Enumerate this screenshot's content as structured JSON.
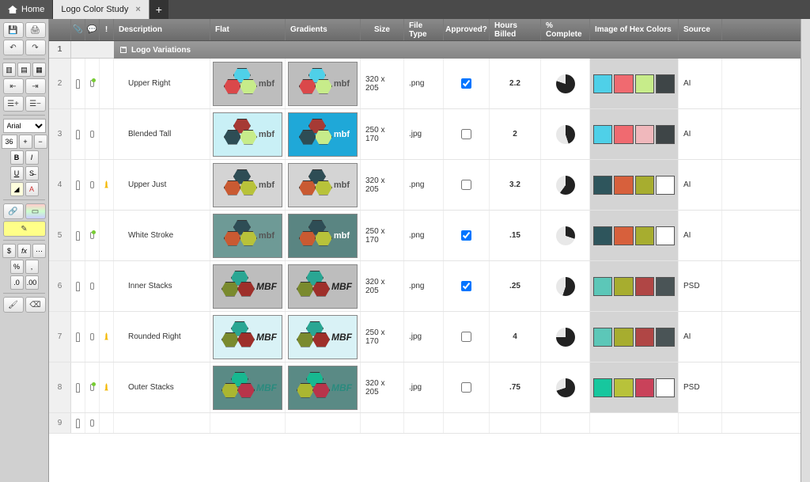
{
  "tabs": {
    "home": "Home",
    "active": "Logo Color Study"
  },
  "toolbar": {
    "font": "Arial",
    "size": "36"
  },
  "headers": {
    "description": "Description",
    "flat": "Flat",
    "gradients": "Gradients",
    "size": "Size",
    "filetype": "File Type",
    "approved": "Approved?",
    "hours": "Hours Billed",
    "pct": "% Complete",
    "hex": "Image of Hex Colors",
    "source": "Source"
  },
  "group": {
    "label": "Logo Variations"
  },
  "rows": [
    {
      "num": "2",
      "desc": "Upper Right",
      "size": "320 x 205",
      "ft": ".png",
      "approved": true,
      "hours": "2.2",
      "pct": 80,
      "src": "AI",
      "comment_has": true,
      "bell": false,
      "flat_bg": "#bdbdbd",
      "grad_bg": "#bdbdbd",
      "logo_text": "mbf",
      "logo_style": "thin",
      "hex_c": [
        "#4fd0e8",
        "#da484a",
        "#c7ec8a"
      ],
      "swatches": [
        "#4fd0e8",
        "#f06a70",
        "#c7ec8a",
        "#3e4547"
      ]
    },
    {
      "num": "3",
      "desc": "Blended Tall",
      "size": "250 x 170",
      "ft": ".jpg",
      "approved": false,
      "hours": "2",
      "pct": 45,
      "src": "AI",
      "comment_has": false,
      "bell": false,
      "flat_bg": "#c9f0f6",
      "grad_bg": "#1fa8d8",
      "logo_text": "mbf",
      "logo_style": "thin",
      "hex_c": [
        "#a63a35",
        "#2e4d55",
        "#c7ec8a"
      ],
      "swatches": [
        "#4fd0e8",
        "#f06a70",
        "#f0b8bc",
        "#3e4547"
      ]
    },
    {
      "num": "4",
      "desc": "Upper Just",
      "size": "320 x 205",
      "ft": ".png",
      "approved": false,
      "hours": "3.2",
      "pct": 60,
      "src": "AI",
      "comment_has": false,
      "bell": true,
      "flat_bg": "#d4d4d4",
      "grad_bg": "#d4d4d4",
      "logo_text": "mbf",
      "logo_style": "thin",
      "hex_c": [
        "#2e4d55",
        "#c95a32",
        "#b8c23a"
      ],
      "swatches": [
        "#2e555c",
        "#d7603c",
        "#a7ad2f",
        "#ffffff"
      ]
    },
    {
      "num": "5",
      "desc": "White Stroke",
      "size": "250 x 170",
      "ft": ".png",
      "approved": true,
      "hours": ".15",
      "pct": 30,
      "src": "AI",
      "comment_has": true,
      "bell": false,
      "flat_bg": "#6e9a96",
      "grad_bg": "#5a8582",
      "logo_text": "mbf",
      "logo_style": "thin",
      "hex_c": [
        "#2e4d55",
        "#c95a32",
        "#b8c23a"
      ],
      "swatches": [
        "#2e555c",
        "#d7603c",
        "#a7ad2f",
        "#ffffff"
      ]
    },
    {
      "num": "6",
      "desc": "Inner Stacks",
      "size": "320 x 205",
      "ft": ".png",
      "approved": true,
      "hours": ".25",
      "pct": 55,
      "src": "PSD",
      "comment_has": false,
      "bell": false,
      "flat_bg": "#bdbdbd",
      "grad_bg": "#bdbdbd",
      "logo_text": "MBF",
      "logo_style": "bold",
      "hex_c": [
        "#2aa693",
        "#7a8a2e",
        "#9e2f2a"
      ],
      "swatches": [
        "#5cc7b8",
        "#a7ad2f",
        "#b04645",
        "#4a5456"
      ]
    },
    {
      "num": "7",
      "desc": "Rounded Right",
      "size": "250 x 170",
      "ft": ".jpg",
      "approved": false,
      "hours": "4",
      "pct": 75,
      "src": "AI",
      "comment_has": false,
      "bell": true,
      "flat_bg": "#d9f2f6",
      "grad_bg": "#d9f2f6",
      "logo_text": "MBF",
      "logo_style": "bold",
      "hex_c": [
        "#2aa693",
        "#7a8a2e",
        "#9e2f2a"
      ],
      "swatches": [
        "#5cc7b8",
        "#a7ad2f",
        "#b04645",
        "#4a5456"
      ]
    },
    {
      "num": "8",
      "desc": "Outer Stacks",
      "size": "320 x 205",
      "ft": ".jpg",
      "approved": false,
      "hours": ".75",
      "pct": 70,
      "src": "PSD",
      "comment_has": true,
      "bell": true,
      "flat_bg": "#5a8a85",
      "grad_bg": "#5a8a85",
      "logo_text": "MBF",
      "logo_style": "teal",
      "hex_c": [
        "#17b890",
        "#aab631",
        "#b8344a"
      ],
      "swatches": [
        "#17c79e",
        "#b8c23a",
        "#c9425a",
        "#ffffff"
      ]
    }
  ],
  "empty_row": "9"
}
